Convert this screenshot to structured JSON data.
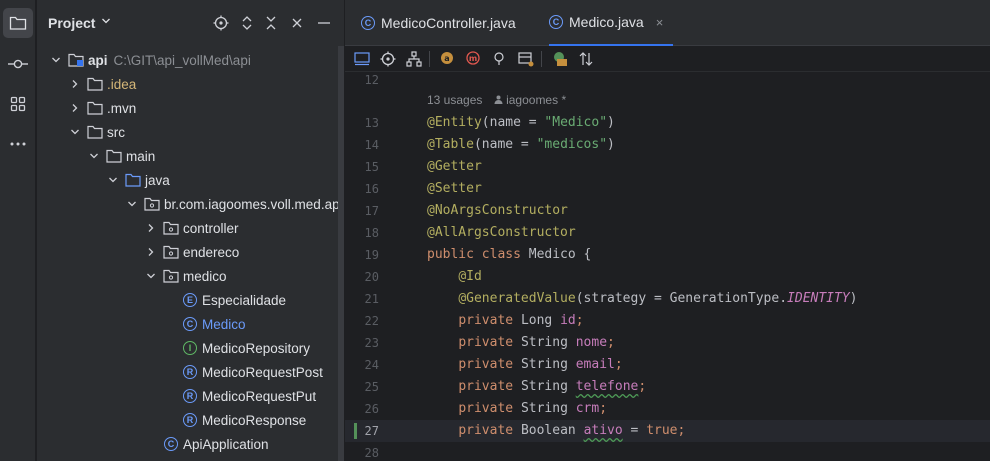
{
  "activity_bar": {
    "items": [
      {
        "name": "project-icon",
        "active": true
      },
      {
        "name": "commit-icon",
        "active": false
      },
      {
        "name": "structure-icon",
        "active": false
      },
      {
        "name": "more-icon",
        "active": false
      }
    ]
  },
  "project_panel": {
    "title": "Project",
    "tools": [
      "locate-icon",
      "expand-collapse-icon",
      "collapse-all-icon",
      "minimize-icon"
    ],
    "tree": [
      {
        "label": "api",
        "suffix": "C:\\GIT\\api_vollMed\\api",
        "depth": 0,
        "expanded": true,
        "icon": "module-folder"
      },
      {
        "label": ".idea",
        "depth": 1,
        "expanded": false,
        "icon": "folder",
        "style": "idea"
      },
      {
        "label": ".mvn",
        "depth": 1,
        "expanded": false,
        "icon": "folder"
      },
      {
        "label": "src",
        "depth": 1,
        "expanded": true,
        "icon": "folder"
      },
      {
        "label": "main",
        "depth": 2,
        "expanded": true,
        "icon": "folder"
      },
      {
        "label": "java",
        "depth": 3,
        "expanded": true,
        "icon": "source-folder"
      },
      {
        "label": "br.com.iagoomes.voll.med.ap",
        "depth": 4,
        "expanded": true,
        "icon": "package"
      },
      {
        "label": "controller",
        "depth": 5,
        "expanded": false,
        "icon": "package"
      },
      {
        "label": "endereco",
        "depth": 5,
        "expanded": false,
        "icon": "package"
      },
      {
        "label": "medico",
        "depth": 5,
        "expanded": true,
        "icon": "package"
      },
      {
        "label": "Especialidade",
        "depth": 6,
        "icon": "enum"
      },
      {
        "label": "Medico",
        "depth": 6,
        "icon": "class",
        "style": "selected"
      },
      {
        "label": "MedicoRepository",
        "depth": 6,
        "icon": "interface"
      },
      {
        "label": "MedicoRequestPost",
        "depth": 6,
        "icon": "record"
      },
      {
        "label": "MedicoRequestPut",
        "depth": 6,
        "icon": "record"
      },
      {
        "label": "MedicoResponse",
        "depth": 6,
        "icon": "record"
      },
      {
        "label": "ApiApplication",
        "depth": 5,
        "icon": "class"
      }
    ]
  },
  "tabs": [
    {
      "label": "MedicoController.java",
      "active": false
    },
    {
      "label": "Medico.java",
      "active": true,
      "close": "×"
    }
  ],
  "editor": {
    "inlay_hint": {
      "usages": "13 usages",
      "author": "iagoomes *"
    },
    "current_line": 27,
    "lines": [
      {
        "num": 12,
        "tokens": []
      },
      {
        "num": 13,
        "tokens": [
          [
            "ann",
            "@Entity"
          ],
          [
            "typ",
            "(name = "
          ],
          [
            "str",
            "\"Medico\""
          ],
          [
            "typ",
            ")"
          ]
        ]
      },
      {
        "num": 14,
        "tokens": [
          [
            "ann",
            "@Table"
          ],
          [
            "typ",
            "(name = "
          ],
          [
            "str",
            "\"medicos\""
          ],
          [
            "typ",
            ")"
          ]
        ]
      },
      {
        "num": 15,
        "tokens": [
          [
            "ann",
            "@Getter"
          ]
        ]
      },
      {
        "num": 16,
        "tokens": [
          [
            "ann",
            "@Setter"
          ]
        ]
      },
      {
        "num": 17,
        "tokens": [
          [
            "ann",
            "@NoArgsConstructor"
          ]
        ]
      },
      {
        "num": 18,
        "tokens": [
          [
            "ann",
            "@AllArgsConstructor"
          ]
        ]
      },
      {
        "num": 19,
        "tokens": [
          [
            "kw",
            "public class "
          ],
          [
            "typ",
            "Medico {"
          ]
        ]
      },
      {
        "num": 20,
        "tokens": [
          [
            "typ",
            "    "
          ],
          [
            "ann",
            "@Id"
          ]
        ]
      },
      {
        "num": 21,
        "tokens": [
          [
            "typ",
            "    "
          ],
          [
            "ann",
            "@GeneratedValue"
          ],
          [
            "typ",
            "(strategy = GenerationType."
          ],
          [
            "stat",
            "IDENTITY"
          ],
          [
            "typ",
            ")"
          ]
        ]
      },
      {
        "num": 22,
        "tokens": [
          [
            "typ",
            "    "
          ],
          [
            "kw",
            "private "
          ],
          [
            "typ",
            "Long "
          ],
          [
            "fld",
            "id"
          ],
          [
            "kw",
            ";"
          ]
        ]
      },
      {
        "num": 23,
        "tokens": [
          [
            "typ",
            "    "
          ],
          [
            "kw",
            "private "
          ],
          [
            "typ",
            "String "
          ],
          [
            "fld",
            "nome"
          ],
          [
            "kw",
            ";"
          ]
        ]
      },
      {
        "num": 24,
        "tokens": [
          [
            "typ",
            "    "
          ],
          [
            "kw",
            "private "
          ],
          [
            "typ",
            "String "
          ],
          [
            "fld",
            "email"
          ],
          [
            "kw",
            ";"
          ]
        ]
      },
      {
        "num": 25,
        "tokens": [
          [
            "typ",
            "    "
          ],
          [
            "kw",
            "private "
          ],
          [
            "typ",
            "String "
          ],
          [
            "fld wavy",
            "telefone"
          ],
          [
            "kw",
            ";"
          ]
        ]
      },
      {
        "num": 26,
        "tokens": [
          [
            "typ",
            "    "
          ],
          [
            "kw",
            "private "
          ],
          [
            "typ",
            "String "
          ],
          [
            "fld",
            "crm"
          ],
          [
            "kw",
            ";"
          ]
        ]
      },
      {
        "num": 27,
        "tokens": [
          [
            "typ",
            "    "
          ],
          [
            "kw",
            "private "
          ],
          [
            "typ",
            "Boolean "
          ],
          [
            "fld wavy",
            "ativo"
          ],
          [
            "typ",
            " = "
          ],
          [
            "kw",
            "true;"
          ]
        ]
      },
      {
        "num": 28,
        "tokens": []
      }
    ]
  },
  "colors": {
    "background": "#1e1f22",
    "panel": "#2b2d30",
    "accent": "#3574f0",
    "annotation": "#b3ae60",
    "keyword": "#cf8e6d",
    "string": "#6aab73",
    "field": "#c77dbb"
  }
}
